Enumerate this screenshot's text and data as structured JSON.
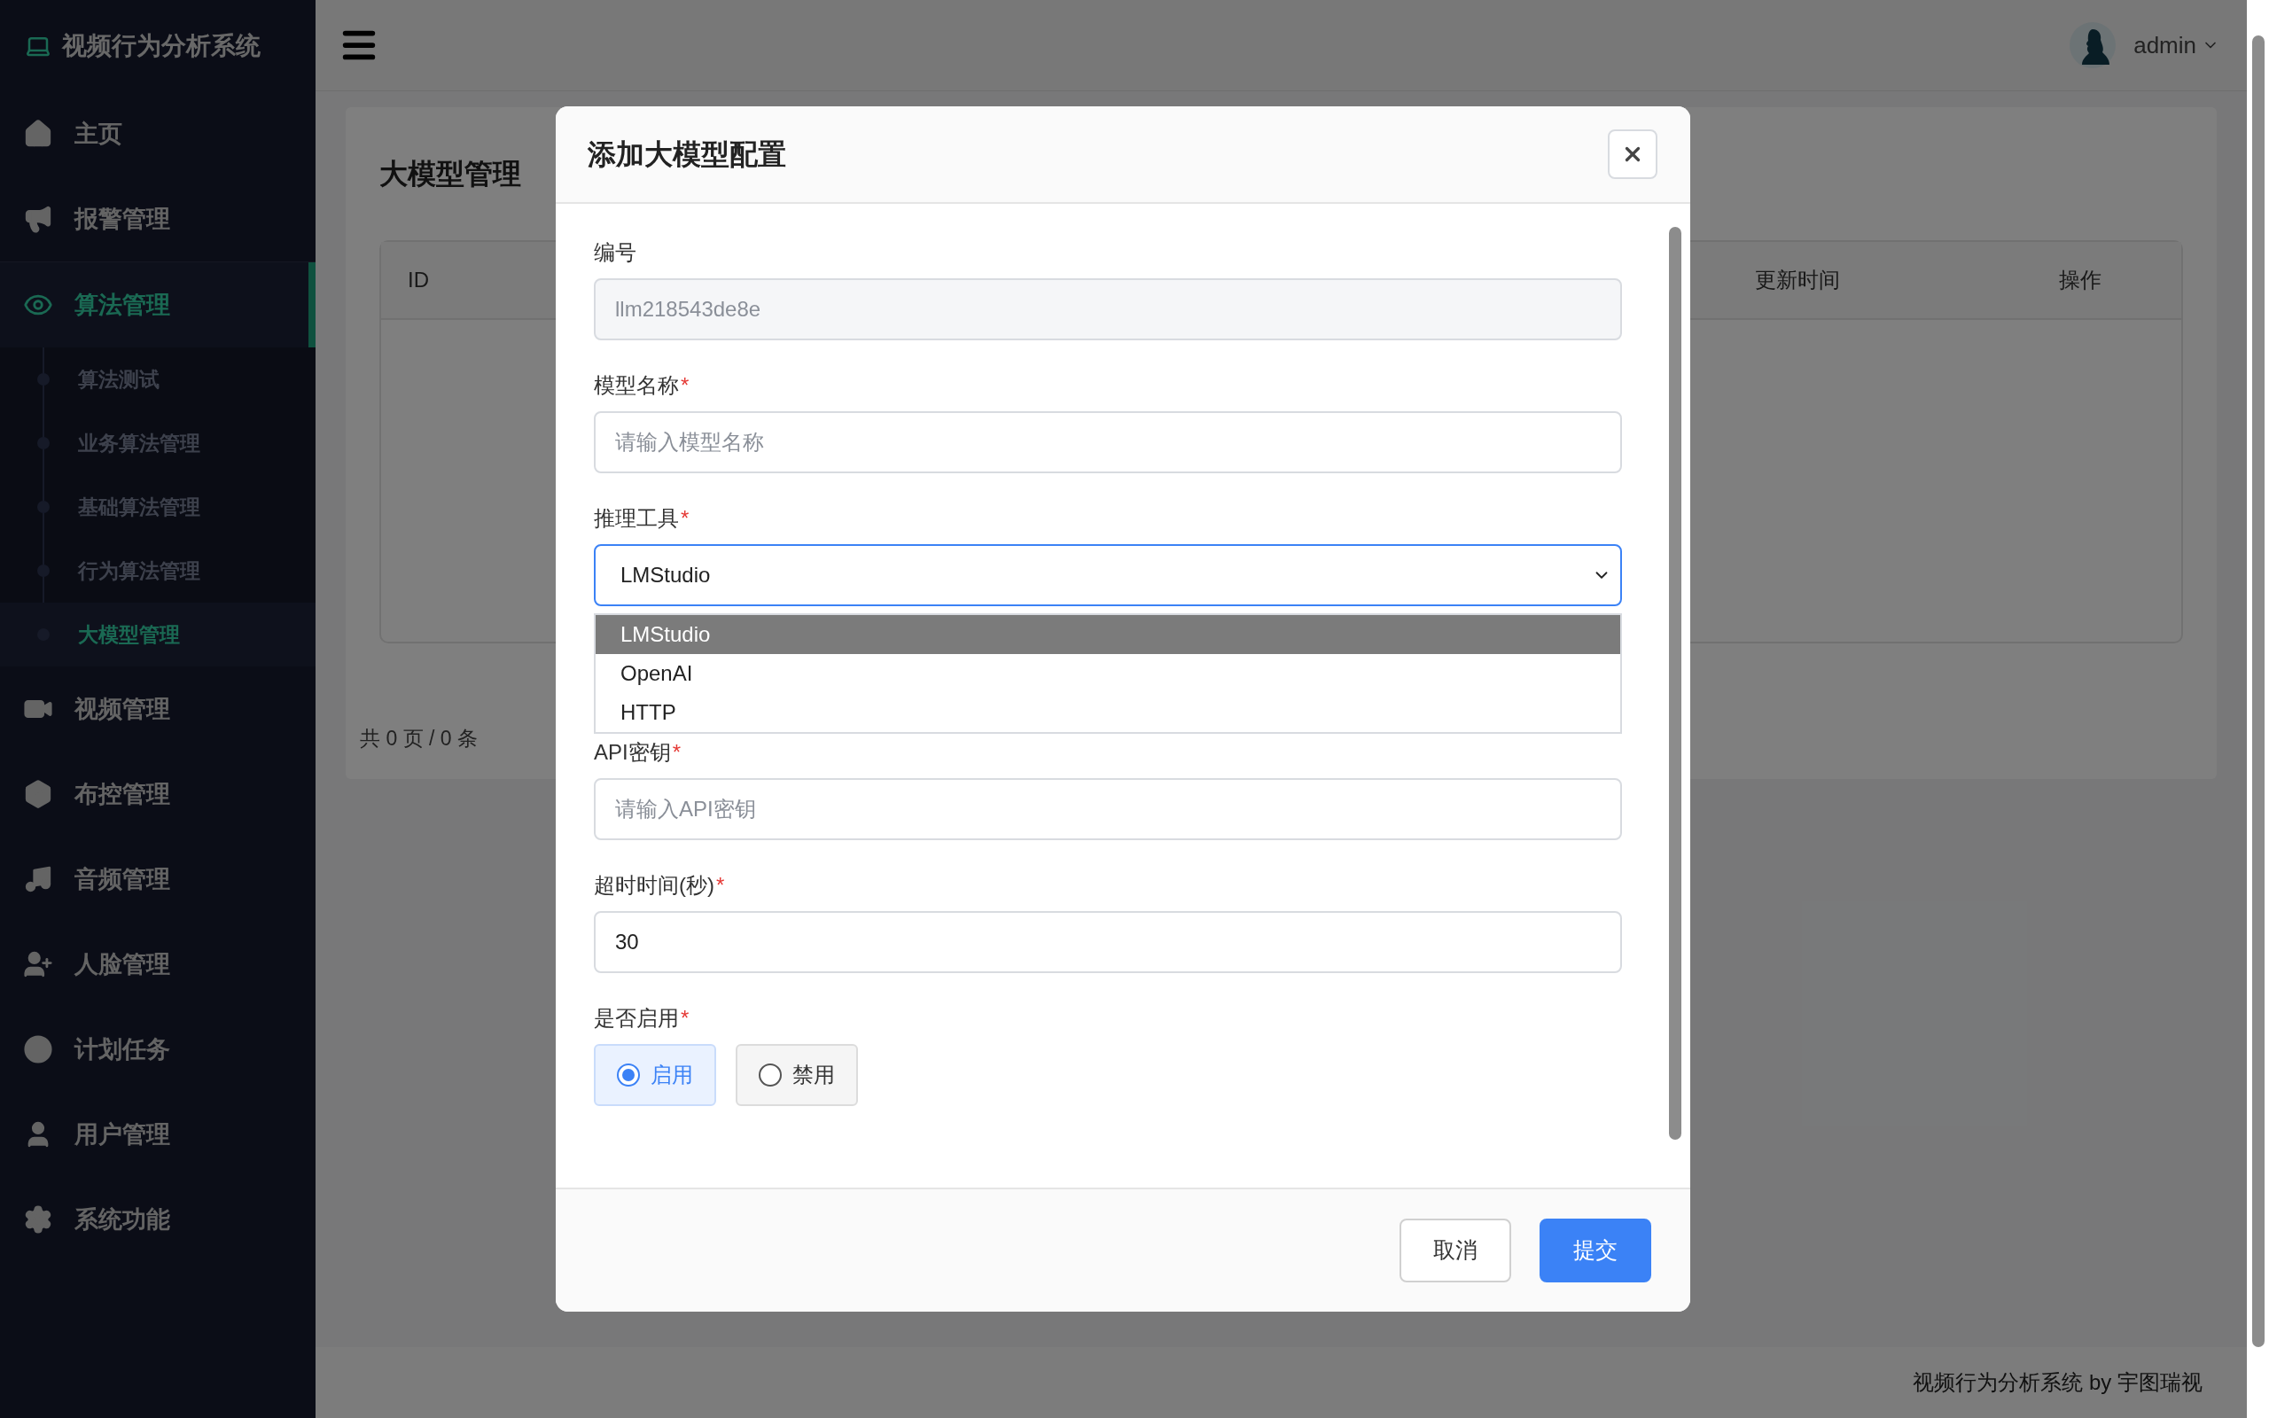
{
  "sidebar": {
    "brand": "视频行为分析系统",
    "items": [
      {
        "label": "主页",
        "selected": false
      },
      {
        "label": "报警管理",
        "selected": false
      },
      {
        "label": "算法管理",
        "selected": true,
        "expanded": true,
        "children": [
          {
            "label": "算法测试",
            "selected": false
          },
          {
            "label": "业务算法管理",
            "selected": false
          },
          {
            "label": "基础算法管理",
            "selected": false
          },
          {
            "label": "行为算法管理",
            "selected": false
          },
          {
            "label": "大模型管理",
            "selected": true
          }
        ]
      },
      {
        "label": "视频管理",
        "selected": false
      },
      {
        "label": "布控管理",
        "selected": false
      },
      {
        "label": "音频管理",
        "selected": false
      },
      {
        "label": "人脸管理",
        "selected": false
      },
      {
        "label": "计划任务",
        "selected": false
      },
      {
        "label": "用户管理",
        "selected": false
      },
      {
        "label": "系统功能",
        "selected": false
      }
    ]
  },
  "header": {
    "user": "admin"
  },
  "page": {
    "title": "大模型管理",
    "table": {
      "columns": [
        "ID",
        "更新时间",
        "操作"
      ]
    },
    "pagination": "共 0 页 / 0 条"
  },
  "footer": "视频行为分析系统 by 宇图瑞视",
  "dialog": {
    "title": "添加大模型配置",
    "fields": [
      {
        "kind": "text",
        "label": "编号",
        "value": "llm218543de8e",
        "disabled": true
      },
      {
        "kind": "text",
        "label": "模型名称",
        "mark": "*",
        "placeholder": "请输入模型名称"
      },
      {
        "kind": "select",
        "label": "推理工具",
        "mark": "*",
        "value": "LMStudio",
        "focused": true,
        "open": true,
        "options": [
          {
            "label": "LMStudio",
            "selected": true
          },
          {
            "label": "OpenAI",
            "selected": false
          },
          {
            "label": "HTTP",
            "selected": false
          }
        ]
      },
      {
        "kind": "covered"
      },
      {
        "kind": "text",
        "label": "API密钥",
        "mark": "*",
        "placeholder": "请输入API密钥"
      },
      {
        "kind": "text",
        "label": "超时时间(秒)",
        "mark": "*",
        "value": "30"
      },
      {
        "kind": "radio",
        "label": "是否启用",
        "mark": "*",
        "options": [
          {
            "label": "启用",
            "selected": true
          },
          {
            "label": "禁用",
            "selected": false
          }
        ]
      }
    ],
    "buttons": [
      {
        "label": "取消",
        "kind": "secondary"
      },
      {
        "label": "提交",
        "kind": "primary"
      }
    ]
  }
}
